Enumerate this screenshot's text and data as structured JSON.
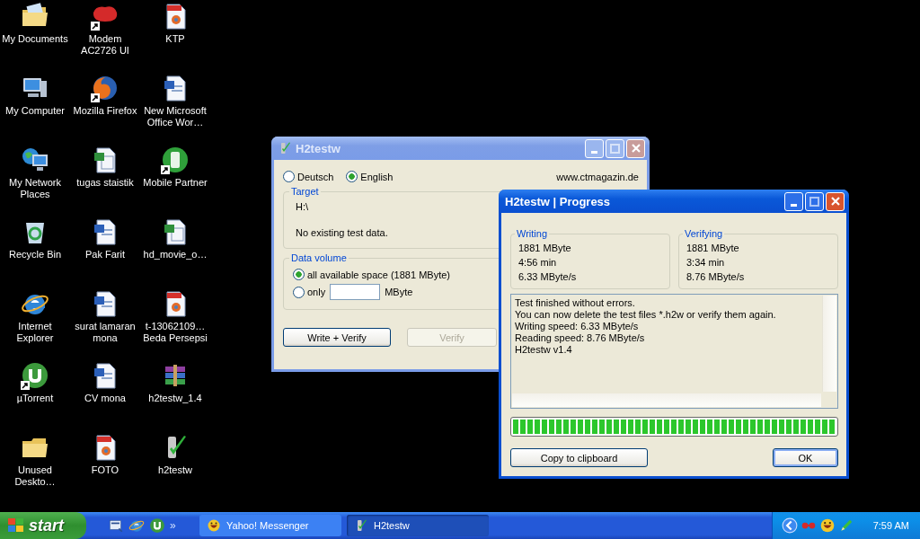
{
  "desktop_icons": [
    {
      "label": "My Documents",
      "kind": "documents-folder",
      "shortcut": false
    },
    {
      "label": "My Computer",
      "kind": "computer",
      "shortcut": false
    },
    {
      "label": "My Network\nPlaces",
      "kind": "network",
      "shortcut": false
    },
    {
      "label": "Recycle Bin",
      "kind": "recycle",
      "shortcut": false
    },
    {
      "label": "Internet\nExplorer",
      "kind": "ie",
      "shortcut": false
    },
    {
      "label": "µTorrent",
      "kind": "torrent",
      "shortcut": true
    },
    {
      "label": "Unused\nDeskto…",
      "kind": "folder",
      "shortcut": false
    },
    {
      "label": "Modem\nAC2726 UI",
      "kind": "smart",
      "shortcut": true
    },
    {
      "label": "Mozilla Firefox",
      "kind": "firefox",
      "shortcut": true
    },
    {
      "label": "tugas staistik",
      "kind": "excel",
      "shortcut": false
    },
    {
      "label": "Pak Farit",
      "kind": "word",
      "shortcut": false
    },
    {
      "label": "surat lamaran\nmona",
      "kind": "word",
      "shortcut": false
    },
    {
      "label": "CV mona",
      "kind": "word",
      "shortcut": false
    },
    {
      "label": "FOTO",
      "kind": "jpg",
      "shortcut": false
    },
    {
      "label": "KTP",
      "kind": "jpg",
      "shortcut": false
    },
    {
      "label": "New Microsoft\nOffice Wor…",
      "kind": "word",
      "shortcut": false
    },
    {
      "label": "Mobile Partner",
      "kind": "mobile",
      "shortcut": true
    },
    {
      "label": "hd_movie_o…",
      "kind": "excel",
      "shortcut": false
    },
    {
      "label": "t-13062109…\nBeda Persepsi",
      "kind": "jpg",
      "shortcut": false
    },
    {
      "label": "h2testw_1.4",
      "kind": "rar",
      "shortcut": false
    },
    {
      "label": "h2testw",
      "kind": "usb",
      "shortcut": false
    }
  ],
  "main_window": {
    "title": "H2testw",
    "active": false,
    "languages": [
      {
        "label": "Deutsch",
        "selected": false
      },
      {
        "label": "English",
        "selected": true
      }
    ],
    "link": "www.ctmagazin.de",
    "target": {
      "title": "Target",
      "drive": "H:\\",
      "status": "No existing test data."
    },
    "data_volume": {
      "title": "Data volume",
      "options": [
        {
          "kind": "all",
          "label": "all available space (1881 MByte)",
          "selected": true
        },
        {
          "kind": "amount",
          "label": "only",
          "unit": "MByte",
          "selected": false
        }
      ]
    },
    "buttons": [
      {
        "label": "Write + Verify",
        "disabled": false
      },
      {
        "label": "Verify",
        "disabled": true
      }
    ]
  },
  "progress_window": {
    "title": "H2testw | Progress",
    "active": true,
    "stats": [
      {
        "title": "Writing",
        "lines": [
          "1881 MByte",
          "4:56 min",
          "6.33 MByte/s"
        ]
      },
      {
        "title": "Verifying",
        "lines": [
          "1881 MByte",
          "3:34 min",
          "8.76 MByte/s"
        ]
      }
    ],
    "log": [
      "Test finished without errors.",
      "You can now delete the test files *.h2w or verify them again.",
      "Writing speed: 6.33 MByte/s",
      "Reading speed: 8.76 MByte/s",
      "H2testw v1.4"
    ],
    "progress": {
      "level": 1
    },
    "buttons": [
      {
        "label": "Copy to clipboard",
        "default": false
      },
      {
        "label": "OK",
        "default": true
      }
    ]
  },
  "taskbar": {
    "start": "start",
    "quick_launch": [
      {
        "kind": "desktop"
      },
      {
        "kind": "ie"
      },
      {
        "kind": "torrent"
      }
    ],
    "quick_launch_more": "»",
    "tasks": [
      {
        "label": "Yahoo! Messenger",
        "kind": "yahoo",
        "selected": false
      },
      {
        "label": "H2testw",
        "kind": "usb",
        "selected": true
      }
    ],
    "tray": [
      {
        "kind": "chevron"
      },
      {
        "kind": "links"
      },
      {
        "kind": "yahoo"
      },
      {
        "kind": "pen"
      }
    ],
    "clock": "7:59 AM"
  }
}
